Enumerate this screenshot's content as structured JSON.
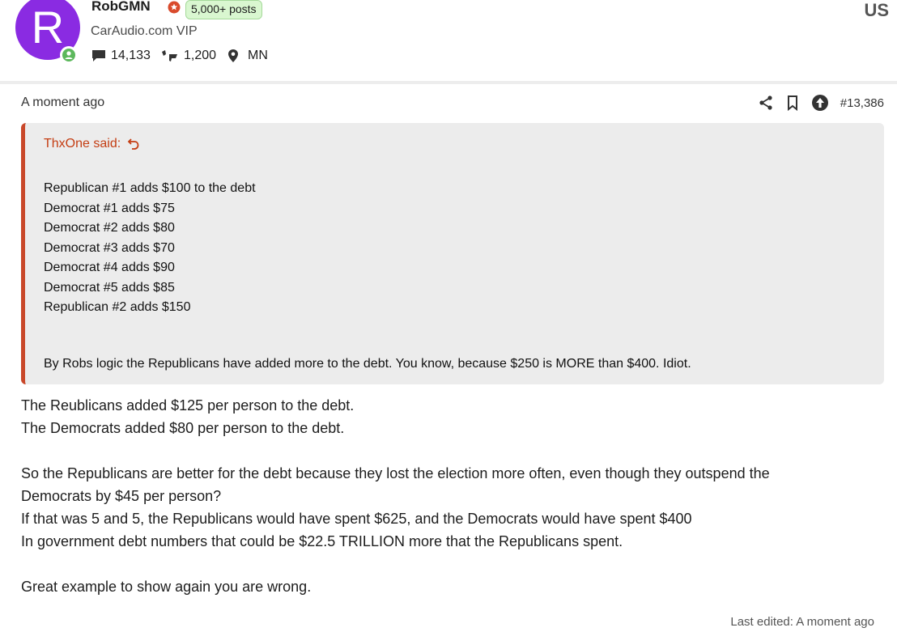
{
  "user": {
    "avatar_letter": "R",
    "name": "RobGMN",
    "posts_badge": "5,000+ posts",
    "title": "CarAudio.com VIP",
    "messages": "14,133",
    "reactions": "1,200",
    "location": "MN",
    "country": "US",
    "avatar_color": "#8a2be2",
    "online_color": "#5cb85c"
  },
  "post": {
    "time": "A moment ago",
    "number": "#13,386",
    "quote": {
      "author": "ThxOne said:",
      "lines": [
        "Republican #1 adds $100 to the debt",
        "Democrat #1 adds $75",
        "Democrat #2 adds $80",
        "Democrat #3 adds $70",
        "Democrat #4 adds $90",
        "Democrat #5 adds $85",
        "Republican #2 adds $150"
      ],
      "tail": "By Robs logic the Republicans have added more to the debt. You know, because $250 is MORE than $400. Idiot.",
      "accent_color": "#c9482a"
    },
    "body": {
      "p1": "The Reublicans added $125 per person to the debt.",
      "p2": "The Democrats added $80 per person to the debt.",
      "p3": "So the Republicans are better for the debt because they lost the election more often, even though they outspend the",
      "p4": "Democrats by $45 per person?",
      "p5": "If that was 5 and 5, the Republicans would have spent $625, and the Democrats would have spent $400",
      "p6": "In government debt numbers that could be $22.5 TRILLION more that the Republicans spent.",
      "p7": "Great example to show again you are wrong."
    },
    "last_edited": "Last edited: A moment ago"
  }
}
